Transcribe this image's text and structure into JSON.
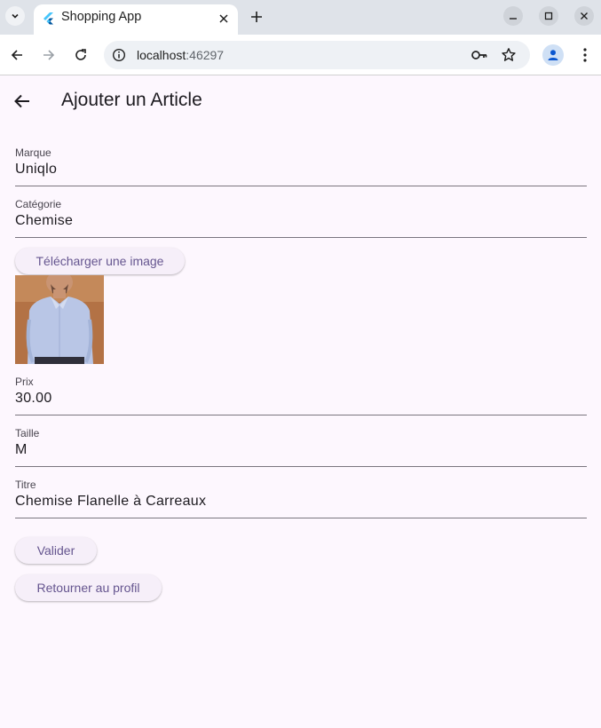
{
  "browser": {
    "tab_title": "Shopping App",
    "url_host": "localhost",
    "url_port": ":46297"
  },
  "app": {
    "title": "Ajouter un Article",
    "fields": {
      "marque": {
        "label": "Marque",
        "value": "Uniqlo"
      },
      "categorie": {
        "label": "Catégorie",
        "value": "Chemise"
      },
      "prix": {
        "label": "Prix",
        "value": "30.00"
      },
      "taille": {
        "label": "Taille",
        "value": "M"
      },
      "titre": {
        "label": "Titre",
        "value": "Chemise Flanelle à Carreaux"
      }
    },
    "buttons": {
      "upload": "Télécharger une image",
      "submit": "Valider",
      "back_profile": "Retourner au profil"
    }
  },
  "colors": {
    "background": "#fdf7fe",
    "accent": "#65558f",
    "button_bg": "#f6eff9"
  }
}
